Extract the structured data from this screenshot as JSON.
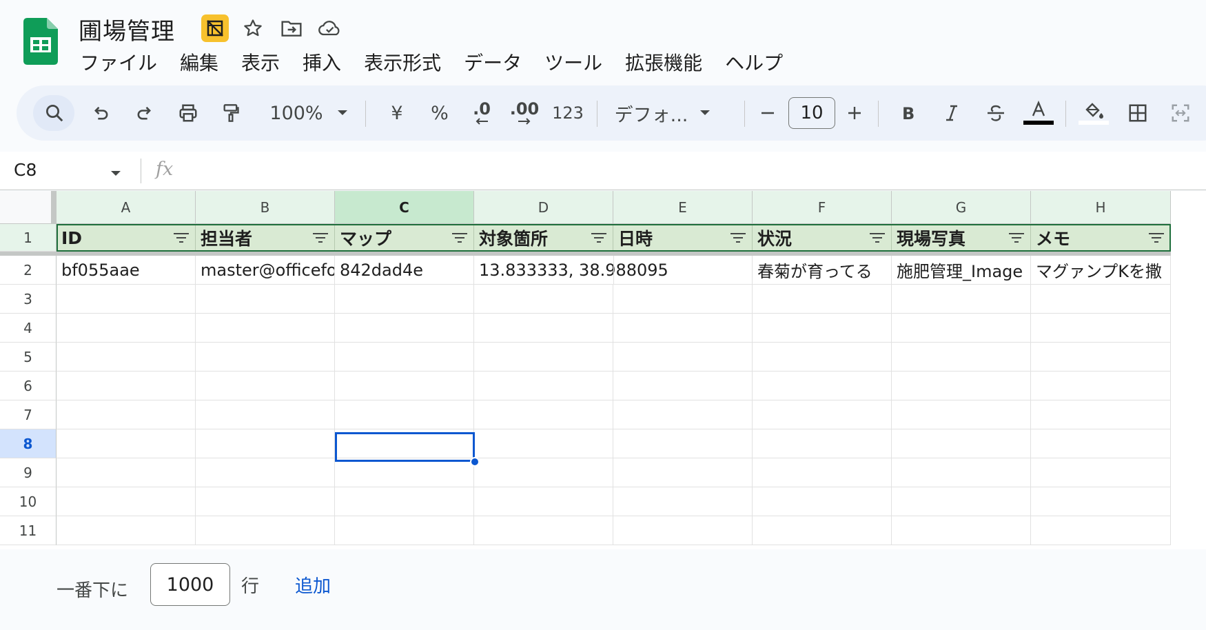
{
  "app": {
    "doc_title": "圃場管理",
    "menu": [
      "ファイル",
      "編集",
      "表示",
      "挿入",
      "表示形式",
      "データ",
      "ツール",
      "拡張機能",
      "ヘルプ"
    ]
  },
  "toolbar": {
    "zoom": "100%",
    "currency": "¥",
    "percent": "%",
    "dec_decrease": ".0",
    "dec_increase": ".00",
    "number_format": "123",
    "font_family": "デフォ...",
    "font_size": "10",
    "accent": "#0b57d0"
  },
  "formula_bar": {
    "cell_ref": "C8",
    "fx": "fx",
    "value": ""
  },
  "sheet": {
    "columns": [
      "A",
      "B",
      "C",
      "D",
      "E",
      "F",
      "G",
      "H"
    ],
    "selected_column": "C",
    "row_numbers": [
      "1",
      "2",
      "3",
      "4",
      "5",
      "6",
      "7",
      "8",
      "9",
      "10",
      "11"
    ],
    "selected_row": "8",
    "header_row": [
      "ID",
      "担当者",
      "マップ",
      "対象箇所",
      "日時",
      "状況",
      "現場写真",
      "メモ"
    ],
    "data_rows": [
      [
        "bf055aae",
        "master@officefo",
        "842dad4e",
        "13.833333, 38.988095",
        "",
        "春菊が育ってる",
        "施肥管理_Image",
        "マグァンプKを撒"
      ]
    ],
    "header_fill": "#d9ead3"
  },
  "footer": {
    "label": "一番下に",
    "rows_value": "1000",
    "unit": "行",
    "add_link": "追加"
  }
}
